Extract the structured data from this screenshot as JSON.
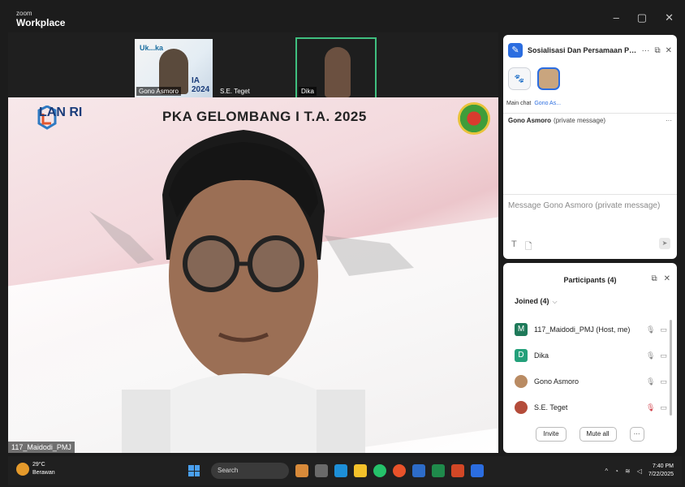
{
  "app": {
    "brand_small": "zoom",
    "brand_big": "Workplace"
  },
  "window_controls": [
    "–",
    "▢",
    "✕"
  ],
  "thumbnails": [
    {
      "name": "Gono Asmoro",
      "logo": "Uk...ka",
      "banner": "IA 2024"
    },
    {
      "name": "S.E. Teget"
    },
    {
      "name": "Dika"
    }
  ],
  "main_video": {
    "brand": "LAN RI",
    "headline": "PKA GELOMBANG I T.A. 2025",
    "speaker_name": "117_Maidodi_PMJ"
  },
  "chat": {
    "title": "Sosialisasi Dan Persamaan Perse...",
    "tools": [
      "···",
      "⧉",
      "✕"
    ],
    "recipient_labels": [
      "Main chat",
      "Gono As..."
    ],
    "pm_name": "Gono Asmoro",
    "pm_sub": "(private message)",
    "pm_more": "···",
    "compose_placeholder": "Message Gono Asmoro (private message)",
    "compose_tools": [
      "T",
      "🗋"
    ],
    "send": "➤"
  },
  "participants": {
    "title": "Participants (4)",
    "tools": [
      "⧉",
      "✕"
    ],
    "joined_label": "Joined (4)",
    "rows": [
      {
        "initial": "M",
        "name": "117_Maidodi_PMJ (Host, me)",
        "color": "#1f7a5a"
      },
      {
        "initial": "D",
        "name": "Dika",
        "color": "#23a07a"
      },
      {
        "initial": "",
        "name": "Gono Asmoro",
        "color": "#b98b63"
      },
      {
        "initial": "",
        "name": "S.E. Teget",
        "color": "#b44c3a"
      }
    ],
    "invite": "Invite",
    "mute_all": "Mute all",
    "more": "···"
  },
  "taskbar": {
    "temp": "29°C",
    "condition": "Berawan",
    "search": "Search",
    "time": "7:40 PM",
    "date": "7/22/2025"
  }
}
